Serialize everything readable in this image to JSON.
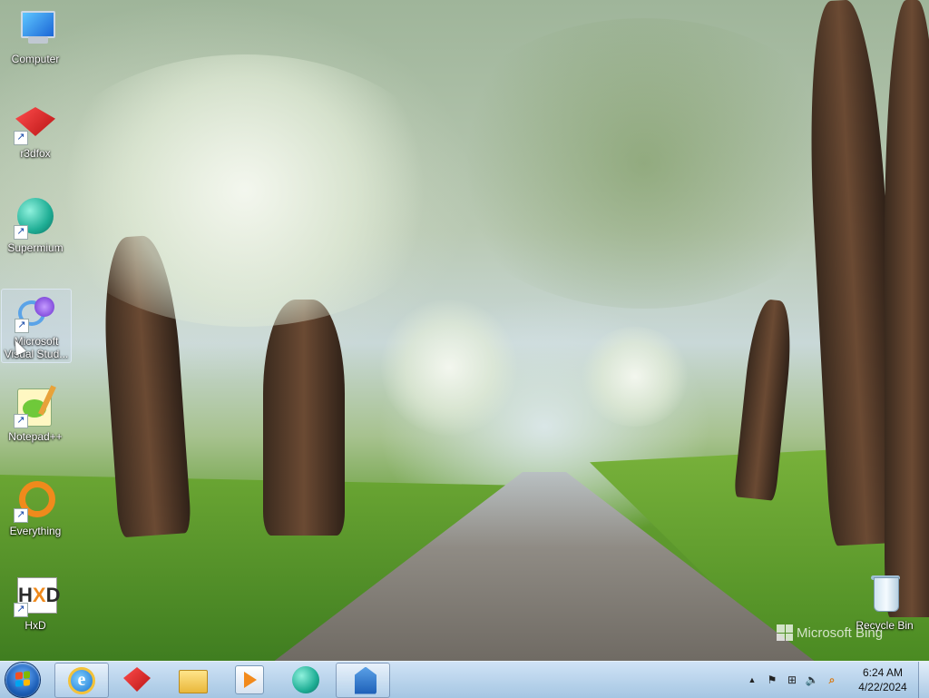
{
  "desktop": {
    "icons": [
      {
        "label": "Computer"
      },
      {
        "label": "r3dfox"
      },
      {
        "label": "Supermium"
      },
      {
        "label": "Microsoft Visual Stud..."
      },
      {
        "label": "Notepad++"
      },
      {
        "label": "Everything"
      },
      {
        "label": "HxD"
      },
      {
        "label": "Recycle Bin"
      }
    ],
    "shortcut_arrow": "↗",
    "watermark": "Microsoft Bing"
  },
  "taskbar": {
    "start_icon": "windows-orb-icon",
    "pinned": [
      {
        "icon": "internet-explorer-icon",
        "glyph": "e",
        "active": true
      },
      {
        "icon": "r3dfox-icon",
        "active": false
      },
      {
        "icon": "file-explorer-icon",
        "active": false
      },
      {
        "icon": "media-player-icon",
        "active": false
      },
      {
        "icon": "supermium-icon",
        "active": false
      },
      {
        "icon": "installer-icon",
        "active": true
      }
    ],
    "tray": {
      "expand_glyph": "▲",
      "flag_glyph": "⚑",
      "network_glyph": "⊞",
      "volume_glyph": "🔈",
      "search_glyph": "⌕"
    },
    "clock": {
      "time": "6:24 AM",
      "date": "4/22/2024"
    }
  },
  "colors": {
    "taskbar_top": "#cde1f5",
    "taskbar_bottom": "#a0c3e1",
    "everything_orange": "#f08a1c"
  }
}
